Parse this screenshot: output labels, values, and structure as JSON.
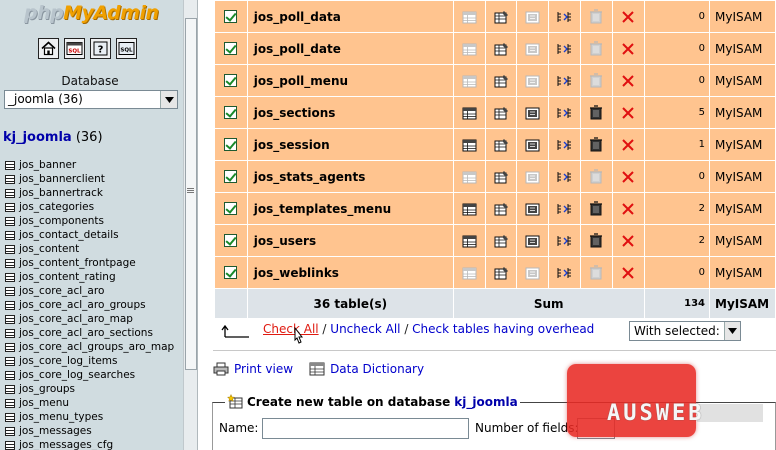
{
  "nav": {
    "logo_part1": "php",
    "logo_part2": "MyAdmin",
    "database_label": "Database",
    "database_selected": "_joomla (36)",
    "db_name": "kj_joomla",
    "db_count": "(36)",
    "tables": [
      "jos_banner",
      "jos_bannerclient",
      "jos_bannertrack",
      "jos_categories",
      "jos_components",
      "jos_contact_details",
      "jos_content",
      "jos_content_frontpage",
      "jos_content_rating",
      "jos_core_acl_aro",
      "jos_core_acl_aro_groups",
      "jos_core_acl_aro_map",
      "jos_core_acl_aro_sections",
      "jos_core_acl_groups_aro_map",
      "jos_core_log_items",
      "jos_core_log_searches",
      "jos_groups",
      "jos_menu",
      "jos_menu_types",
      "jos_messages",
      "jos_messages_cfg"
    ]
  },
  "table": {
    "rows": [
      {
        "name": "jos_poll_data",
        "records": "0",
        "type": "MyISAM",
        "empty": true
      },
      {
        "name": "jos_poll_date",
        "records": "0",
        "type": "MyISAM",
        "empty": true
      },
      {
        "name": "jos_poll_menu",
        "records": "0",
        "type": "MyISAM",
        "empty": true
      },
      {
        "name": "jos_sections",
        "records": "5",
        "type": "MyISAM",
        "empty": false
      },
      {
        "name": "jos_session",
        "records": "1",
        "type": "MyISAM",
        "empty": false
      },
      {
        "name": "jos_stats_agents",
        "records": "0",
        "type": "MyISAM",
        "empty": true
      },
      {
        "name": "jos_templates_menu",
        "records": "2",
        "type": "MyISAM",
        "empty": false
      },
      {
        "name": "jos_users",
        "records": "2",
        "type": "MyISAM",
        "empty": false
      },
      {
        "name": "jos_weblinks",
        "records": "0",
        "type": "MyISAM",
        "empty": true
      }
    ],
    "summary": {
      "tables": "36 table(s)",
      "sum": "Sum",
      "records": "134",
      "type": "MyISAM"
    }
  },
  "check_bar": {
    "check_all": "Check All",
    "sep1": " / ",
    "uncheck_all": "Uncheck All",
    "sep2": " / ",
    "check_overhead": "Check tables having overhead",
    "with_selected": "With selected:"
  },
  "links": {
    "print_view": "Print view",
    "data_dictionary": "Data Dictionary"
  },
  "create_table": {
    "legend": "Create new table on database",
    "db_name": "kj_joomla",
    "name_label": "Name:",
    "fields_label": "Number of fields:"
  },
  "watermark": "AUSWEB",
  "colors": {
    "row_bg": "#ffc48f",
    "summary_bg": "#dde3e8",
    "nav_bg": "#d0dce0",
    "link": "#0000cc",
    "link_hover": "#e01a10"
  }
}
